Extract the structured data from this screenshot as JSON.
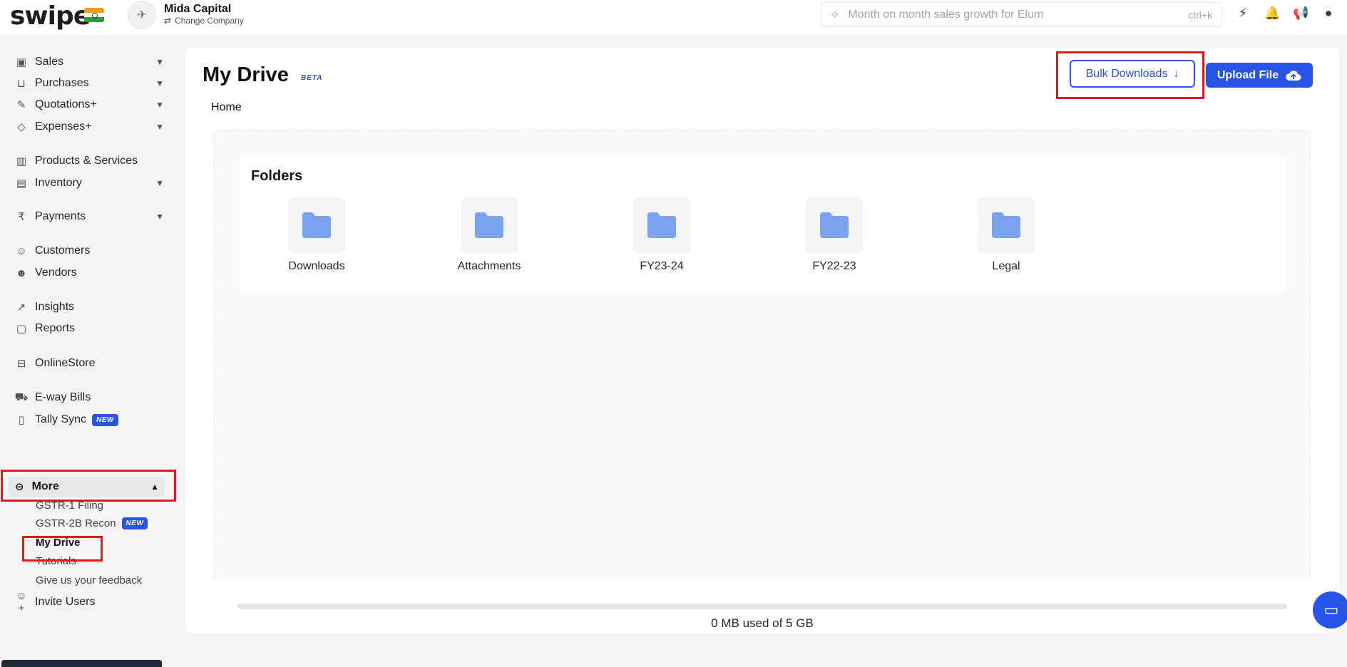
{
  "topbar": {
    "logo": "swipe",
    "company_name": "Mida Capital",
    "change_company": "Change Company",
    "search_placeholder": "Month on month sales growth for Elum",
    "search_shortcut": "ctrl+k"
  },
  "sidebar": {
    "items": [
      {
        "label": "Sales"
      },
      {
        "label": "Purchases"
      },
      {
        "label": "Quotations+"
      },
      {
        "label": "Expenses+"
      },
      {
        "label": "Products & Services"
      },
      {
        "label": "Inventory"
      },
      {
        "label": "Payments"
      },
      {
        "label": "Customers"
      },
      {
        "label": "Vendors"
      },
      {
        "label": "Insights"
      },
      {
        "label": "Reports"
      },
      {
        "label": "OnlineStore"
      },
      {
        "label": "E-way Bills"
      },
      {
        "label": "Tally Sync",
        "badge": "NEW"
      },
      {
        "label": "More"
      },
      {
        "label": "Invite Users"
      }
    ],
    "more_submenu": [
      {
        "label": "GSTR-1 Filing"
      },
      {
        "label": "GSTR-2B Recon",
        "badge": "NEW"
      },
      {
        "label": "My Drive"
      },
      {
        "label": "Tutorials"
      },
      {
        "label": "Give us your feedback"
      }
    ]
  },
  "main": {
    "title": "My Drive",
    "beta_label": "BETA",
    "breadcrumb": "Home",
    "bulk_downloads_label": "Bulk Downloads",
    "upload_file_label": "Upload File",
    "folders_title": "Folders",
    "folders": [
      {
        "name": "Downloads"
      },
      {
        "name": "Attachments"
      },
      {
        "name": "FY23-24"
      },
      {
        "name": "FY22-23"
      },
      {
        "name": "Legal"
      }
    ],
    "storage_used_fraction": 0,
    "storage_text": "0 MB used of 5 GB"
  },
  "colors": {
    "accent": "#2754e6",
    "highlight_box": "#dc1c1c",
    "folder": "#7aa2f0"
  }
}
